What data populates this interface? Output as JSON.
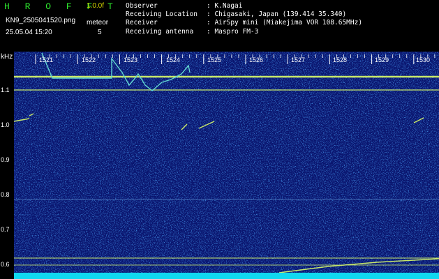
{
  "header": {
    "app_title": "H R O F F T",
    "version": "1.0.0f",
    "filename": "KN9_2505041520.png",
    "meteor_label": "meteor",
    "datetime": "25.05.04 15:20",
    "meteor_count": "5",
    "info": [
      {
        "key": "Observer",
        "value": ": K.Nagai"
      },
      {
        "key": "Receiving Location",
        "value": ": Chigasaki, Japan (139.414 35.340)"
      },
      {
        "key": "Receiver",
        "value": ": AirSpy mini (Miakejima VOR 108.65MHz)"
      },
      {
        "key": "Receiving antenna",
        "value": ": Maspro FM-3"
      }
    ]
  },
  "axis": {
    "unit": "kHz",
    "y_labels": [
      "1.1",
      "1.0",
      "0.9",
      "0.8",
      "0.7",
      "0.6"
    ],
    "y_values": [
      1.1,
      1.0,
      0.9,
      0.8,
      0.7,
      0.6
    ],
    "time_labels": [
      "1521",
      "1522",
      "1523",
      "1524",
      "1525",
      "1526",
      "1527",
      "1528",
      "1529",
      "1530"
    ]
  },
  "colors": {
    "background": "#0a1670",
    "trace": "#c8e86a",
    "noise_floor": "#10d8f0",
    "title_green": "#2ee82e",
    "version_yellow": "#d8d800"
  }
}
